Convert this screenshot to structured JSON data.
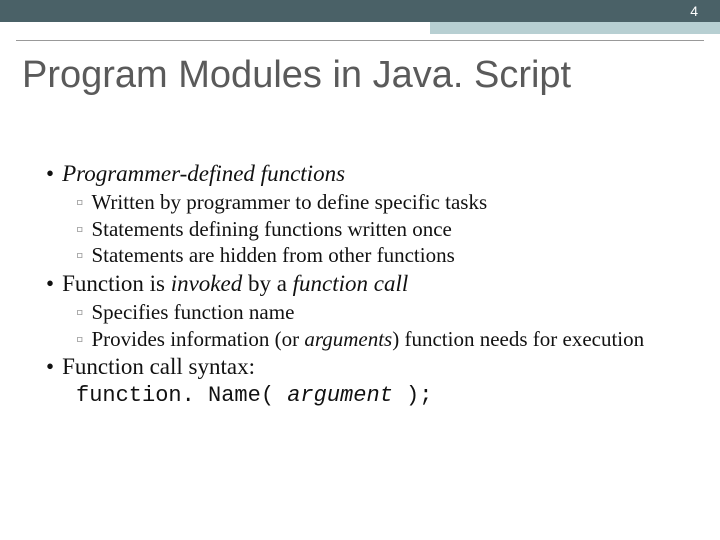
{
  "slide_number": "4",
  "title": "Program Modules in Java. Script",
  "bullets": {
    "b1_1_prefix": "Programmer-defined functions",
    "b1_1_sub1": "Written by programmer to define specific tasks",
    "b1_1_sub2": "Statements defining functions written once",
    "b1_1_sub3": "Statements are hidden from other functions",
    "b1_2_prefix": "Function is ",
    "b1_2_mid": "invoked",
    "b1_2_mid2": " by a ",
    "b1_2_suffix": "function call",
    "b1_2_sub1": "Specifies function name",
    "b1_2_sub2_a": "Provides information (or ",
    "b1_2_sub2_b": "arguments",
    "b1_2_sub2_c": ") function needs for execution",
    "b1_3": "Function call syntax:",
    "code_a": "function. Name( ",
    "code_b": "argument",
    "code_c": " );"
  }
}
